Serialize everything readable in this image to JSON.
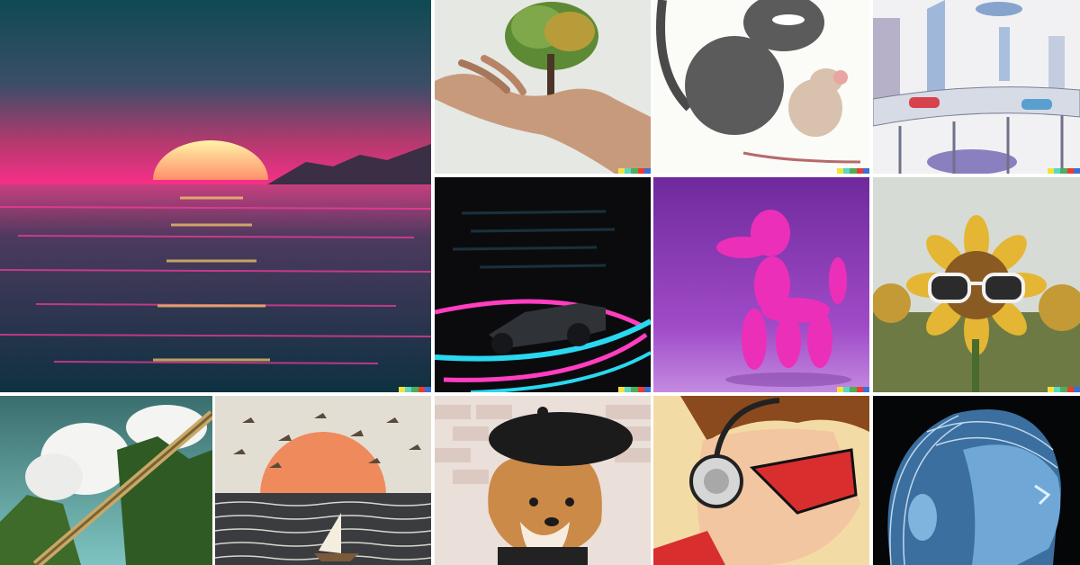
{
  "tiles": [
    {
      "name": "synthwave-sunset-ocean",
      "dominant": "#e63b8a"
    },
    {
      "name": "tree-growing-from-hand",
      "dominant": "#7ea84a"
    },
    {
      "name": "cartoon-cat-and-mouse",
      "dominant": "#5b5b5b"
    },
    {
      "name": "sketched-futuristic-city",
      "dominant": "#9fb7d8"
    },
    {
      "name": "neon-race-car",
      "dominant": "#e02ea6"
    },
    {
      "name": "pink-balloon-dog",
      "dominant": "#ec2fb8"
    },
    {
      "name": "sunflower-with-sunglasses",
      "dominant": "#e5b633"
    },
    {
      "name": "green-cliffs-and-clouds",
      "dominant": "#3e6a2a"
    },
    {
      "name": "birds-over-sunset-sea",
      "dominant": "#ee8a5c"
    },
    {
      "name": "shiba-inu-in-beret",
      "dominant": "#cc8a48"
    },
    {
      "name": "comic-hero-with-headphones",
      "dominant": "#d92e2e"
    },
    {
      "name": "blue-glass-head",
      "dominant": "#4f8fc4"
    }
  ],
  "signature_colors": [
    "#f2e33a",
    "#5cd6c6",
    "#4cae5a",
    "#ee3b2d",
    "#3a6fd8"
  ]
}
